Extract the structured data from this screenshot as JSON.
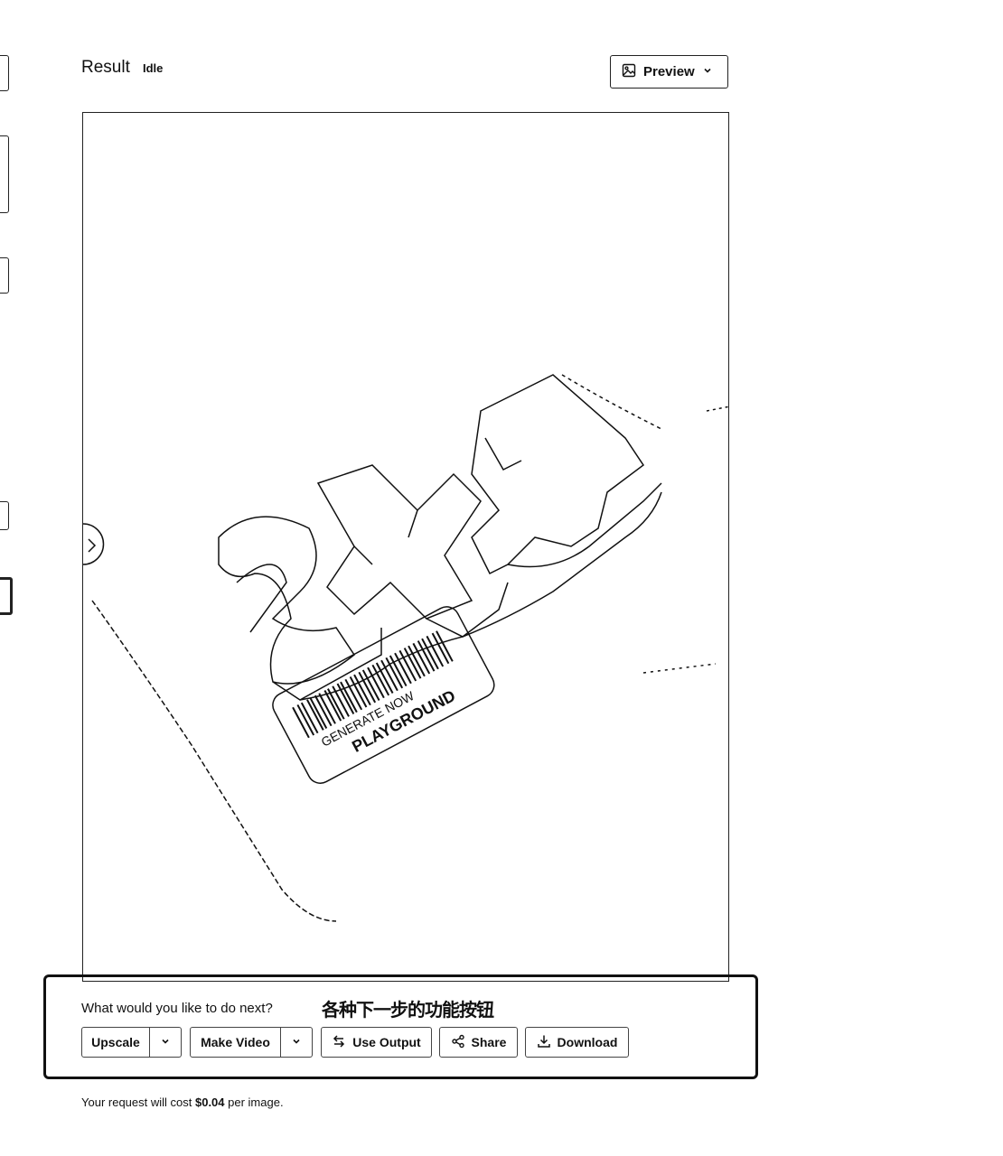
{
  "header": {
    "title": "Result",
    "status": "Idle",
    "preview_label": "Preview"
  },
  "image": {
    "sticker_text_1": "GENERATE NOW",
    "sticker_text_2": "PLAYGROUND"
  },
  "next_actions": {
    "prompt": "What would you like to do next?",
    "annotation": "各种下一步的功能按钮",
    "buttons": {
      "upscale": "Upscale",
      "make_video": "Make Video",
      "use_output": "Use Output",
      "share": "Share",
      "download": "Download"
    }
  },
  "footer": {
    "cost_prefix": "Your request will cost ",
    "cost_value": "$0.04",
    "cost_suffix": " per image."
  },
  "icons": {
    "preview": "image-icon",
    "chevron": "chevron-down-icon",
    "use_output": "swap-arrows-icon",
    "share": "share-icon",
    "download": "download-icon"
  }
}
